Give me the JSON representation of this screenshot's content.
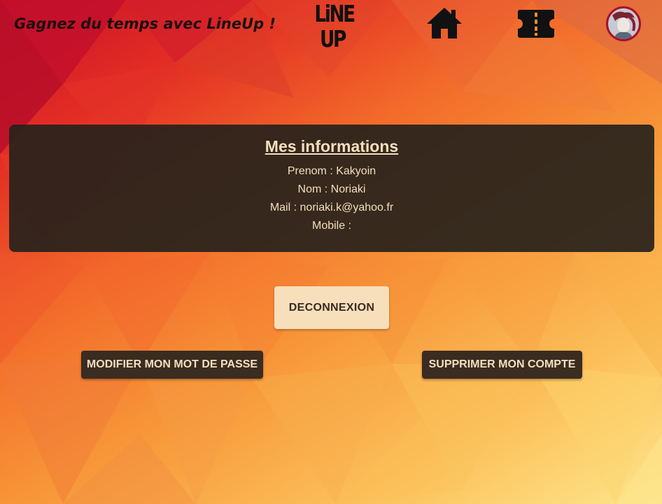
{
  "header": {
    "tagline": "Gagnez du temps avec LineUp !",
    "logo_top": "LiNE",
    "logo_bottom": "UP",
    "icons": {
      "home": "home-icon",
      "tickets": "ticket-icon",
      "profile": "avatar"
    }
  },
  "info": {
    "title": "Mes informations",
    "prenom_label": "Prenom",
    "prenom_value": "Kakyoin",
    "nom_label": "Nom",
    "nom_value": "Noriaki",
    "mail_label": "Mail",
    "mail_value": "noriaki.k@yahoo.fr",
    "mobile_label": "Mobile",
    "mobile_value": ""
  },
  "actions": {
    "logout": "DECONNEXION",
    "change_password": "MODIFIER MON MOT DE PASSE",
    "delete_account": "SUPPRIMER MON COMPTE"
  },
  "colors": {
    "card_bg": "#28221c",
    "accent_text": "#f6dfbf",
    "logout_bg": "#f6dfba",
    "dark_button_bg": "#3a2c20"
  }
}
